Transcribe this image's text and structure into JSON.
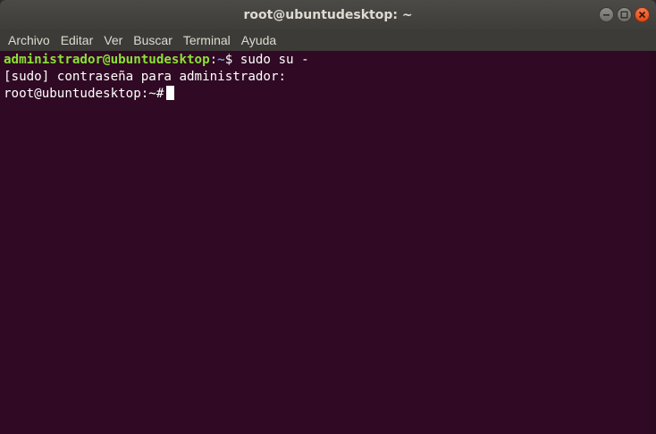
{
  "window": {
    "title": "root@ubuntudesktop: ~",
    "buttons": {
      "minimize_icon": "minimize-icon",
      "maximize_icon": "maximize-icon",
      "close_icon": "close-icon"
    }
  },
  "menu": {
    "items": [
      "Archivo",
      "Editar",
      "Ver",
      "Buscar",
      "Terminal",
      "Ayuda"
    ]
  },
  "terminal": {
    "lines": [
      {
        "user_host": "administrador@ubuntudesktop",
        "separator": ":",
        "path": "~",
        "prompt_char": "$",
        "command": " sudo su -"
      },
      {
        "text": "[sudo] contraseña para administrador:"
      },
      {
        "prompt": "root@ubuntudesktop:~#"
      }
    ]
  },
  "colors": {
    "background": "#300a24",
    "prompt_user": "#8ae234",
    "prompt_path": "#729fcf",
    "text": "#ffffff",
    "titlebar": "#3c3b37",
    "close_button": "#df4a16"
  }
}
